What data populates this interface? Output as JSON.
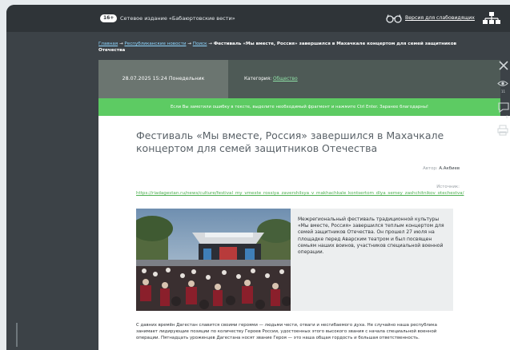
{
  "header": {
    "age_badge": "16+",
    "site_name": "Сетевое издание «Бабаюртовские вести»",
    "visually_impaired_link": "Версия для слабовидящих",
    "icons": [
      "glasses-icon",
      "sitemap-icon"
    ]
  },
  "breadcrumb": {
    "items": [
      "Главная",
      "Республиканские новости",
      "Поиск"
    ],
    "separator": "→",
    "current": "Фестиваль «Мы вместе, Россия» завершился в Махачкале концертом для семей защитников Отечества"
  },
  "meta": {
    "date": "28.07.2025 15:24 Понедельник",
    "category_label": "Категория:",
    "category_value": "Общество"
  },
  "error_notice": "Если Вы заметили ошибку в тексте, выделите необходимый фрагмент и нажмите Ctrl Enter. Заранее благодарны!",
  "article": {
    "title": "Фестиваль «Мы вместе, Россия» завершился в Махачкале концертом для семей защитников Отечества",
    "author_label": "Автор:",
    "author": "А.Акбиев",
    "source_label": "Источник:",
    "source_url": "https://riadagestan.ru/news/culture/festival_my_vmeste_rossiya_zavershilsya_v_makhachkale_kontsertom_dlya_semey_zashchitnikov_otechestva/",
    "lead": "Межрегиональный фестиваль традиционной культуры «Мы вместе, Россия» завершился теплым концертом для семей защитников Отечества. Он прошел 27 июля на площадке перед Аварским театром и был посвящен семьям наших воинов, участников специальной военной операции.",
    "body": "С давних времён Дагестан славится своими героями — людьми чести, отваги и несгибаемого духа. Не случайно наша республика занимает лидирующие позиции по количеству Героев России, удостоенных этого высокого звания с начала специальной военной операции. Пятнадцать уроженцев Дагестана носят звание Героя — это наша общая гордость и большая ответственность."
  },
  "toolbar": {
    "views_count": "11",
    "comments_count": "0",
    "icons": [
      "close-icon",
      "eye-icon",
      "comment-icon",
      "print-icon"
    ]
  },
  "colors": {
    "header_bg": "#2f3438",
    "page_bg": "#3c4247",
    "date_bg": "#6b7570",
    "info_bg": "#4e5a56",
    "accent_green": "#5dcb63",
    "link_green": "#4caf50",
    "link_blue": "#8fd6ff"
  }
}
